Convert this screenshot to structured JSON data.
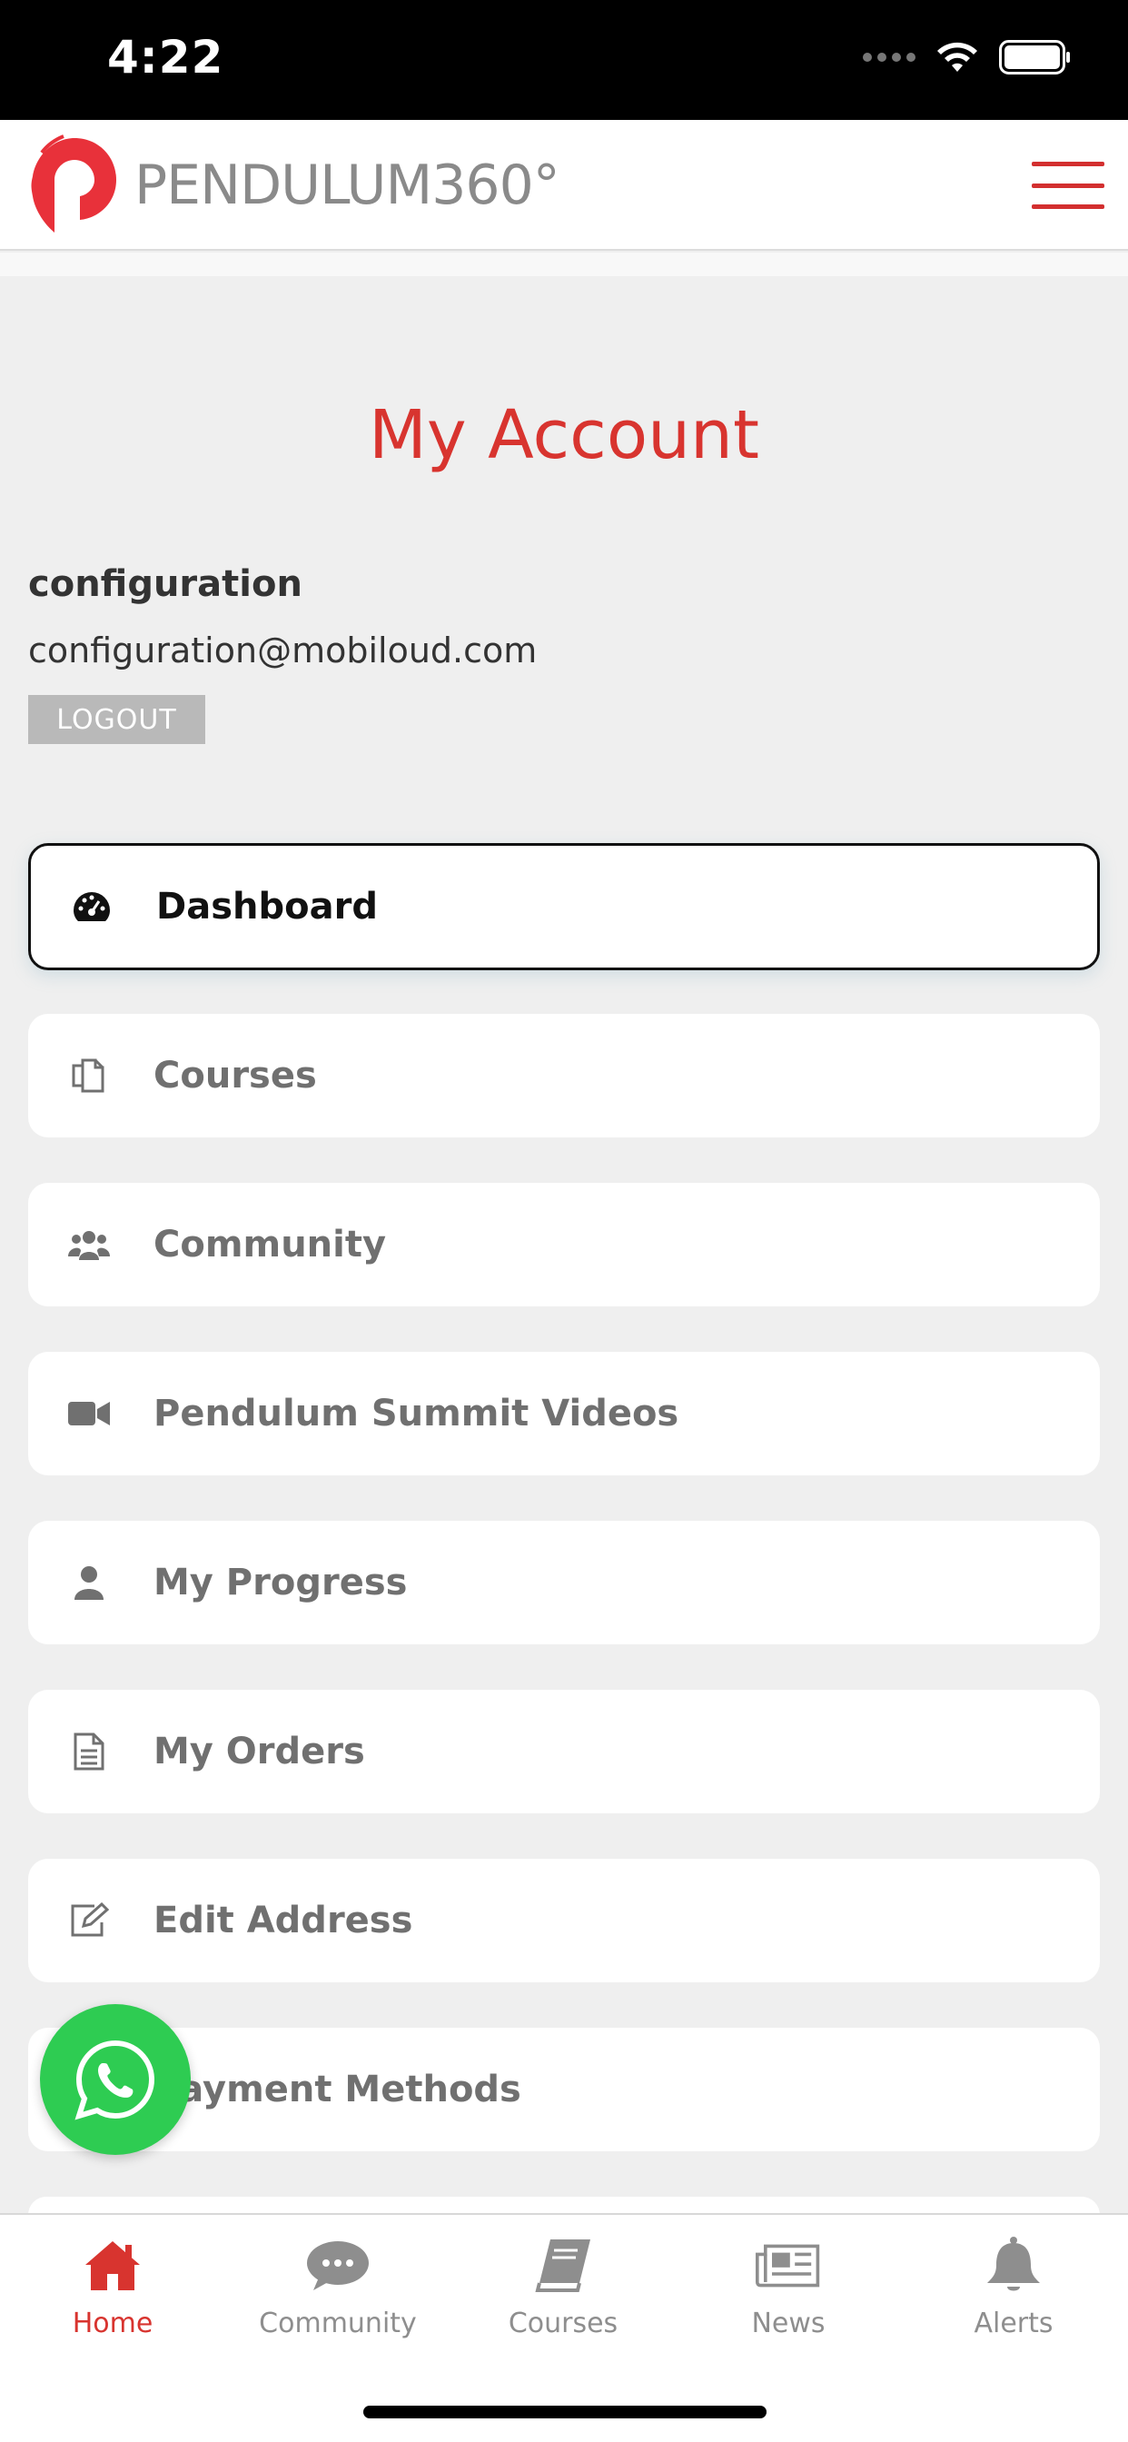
{
  "status_bar": {
    "time": "4:22"
  },
  "header": {
    "logo_text": "PENDULUM360°",
    "menu_icon": "hamburger-icon"
  },
  "page": {
    "title": "My Account"
  },
  "user": {
    "name": "configuration",
    "email": "configuration@mobiloud.com",
    "logout_label": "LOGOUT"
  },
  "menu": {
    "items": [
      {
        "label": "Dashboard",
        "icon": "dashboard-icon",
        "active": true
      },
      {
        "label": "Courses",
        "icon": "copy-icon"
      },
      {
        "label": "Community",
        "icon": "users-icon"
      },
      {
        "label": "Pendulum Summit Videos",
        "icon": "video-camera-icon"
      },
      {
        "label": "My Progress",
        "icon": "user-icon"
      },
      {
        "label": "My Orders",
        "icon": "document-icon"
      },
      {
        "label": "Edit Address",
        "icon": "edit-icon"
      },
      {
        "label": "Payment Methods",
        "icon": "credit-card-icon"
      }
    ]
  },
  "tabs": [
    {
      "label": "Home",
      "icon": "home-icon",
      "active": true
    },
    {
      "label": "Community",
      "icon": "chat-bubble-icon"
    },
    {
      "label": "Courses",
      "icon": "book-icon"
    },
    {
      "label": "News",
      "icon": "newspaper-icon"
    },
    {
      "label": "Alerts",
      "icon": "bell-icon"
    }
  ],
  "colors": {
    "accent": "#d8342f",
    "whatsapp": "#2ecc52"
  }
}
